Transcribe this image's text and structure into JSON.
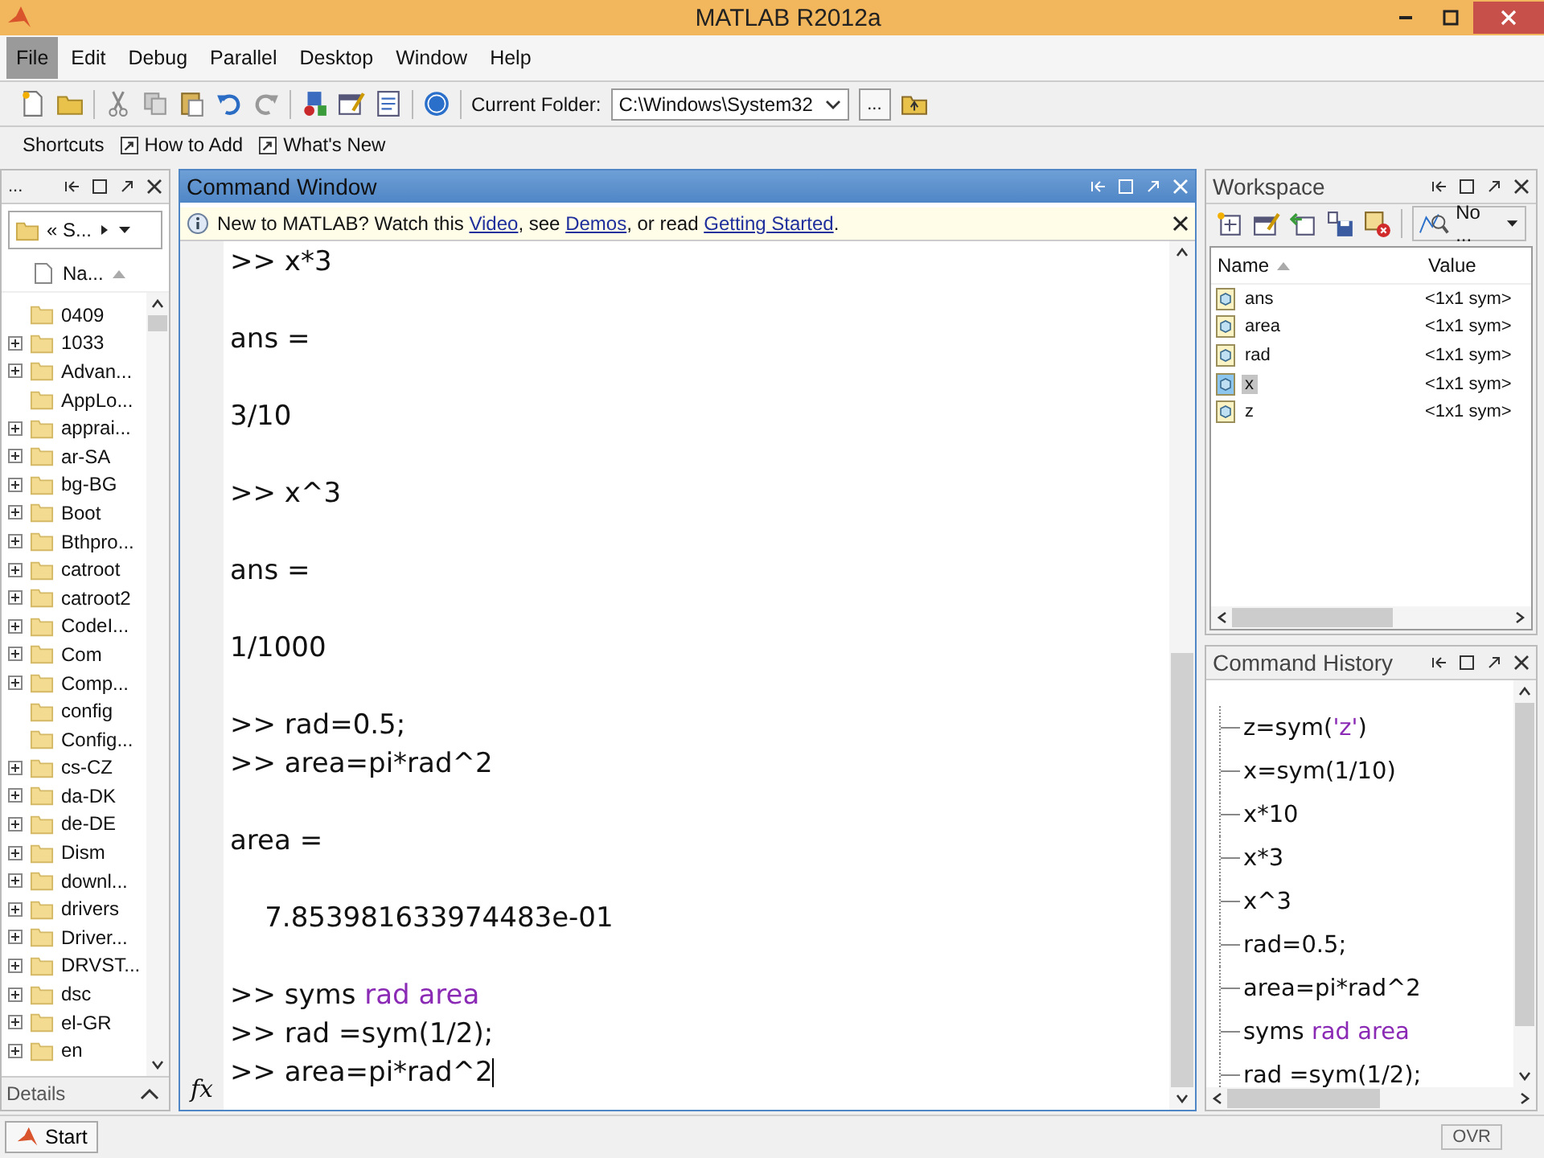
{
  "window": {
    "title": "MATLAB  R2012a"
  },
  "menu": [
    {
      "label": "File",
      "selected": true
    },
    {
      "label": "Edit",
      "selected": false
    },
    {
      "label": "Debug",
      "selected": false
    },
    {
      "label": "Parallel",
      "selected": false
    },
    {
      "label": "Desktop",
      "selected": false
    },
    {
      "label": "Window",
      "selected": false
    },
    {
      "label": "Help",
      "selected": false
    }
  ],
  "toolbar": {
    "current_folder_label": "Current Folder:",
    "current_folder": "C:\\Windows\\System32",
    "browse_button": "..."
  },
  "shortcuts": {
    "title": "Shortcuts",
    "items": [
      "How to Add",
      "What's New"
    ]
  },
  "file_browser": {
    "header": "...",
    "address": "« S...",
    "column": "Na...",
    "details": "Details",
    "items": [
      {
        "name": "0409",
        "expandable": false
      },
      {
        "name": "1033",
        "expandable": true
      },
      {
        "name": "Advan...",
        "expandable": true
      },
      {
        "name": "AppLo...",
        "expandable": false
      },
      {
        "name": "apprai...",
        "expandable": true
      },
      {
        "name": "ar-SA",
        "expandable": true
      },
      {
        "name": "bg-BG",
        "expandable": true
      },
      {
        "name": "Boot",
        "expandable": true
      },
      {
        "name": "Bthpro...",
        "expandable": true
      },
      {
        "name": "catroot",
        "expandable": true
      },
      {
        "name": "catroot2",
        "expandable": true
      },
      {
        "name": "CodeI...",
        "expandable": true
      },
      {
        "name": "Com",
        "expandable": true
      },
      {
        "name": "Comp...",
        "expandable": true
      },
      {
        "name": "config",
        "expandable": false
      },
      {
        "name": "Config...",
        "expandable": false
      },
      {
        "name": "cs-CZ",
        "expandable": true
      },
      {
        "name": "da-DK",
        "expandable": true
      },
      {
        "name": "de-DE",
        "expandable": true
      },
      {
        "name": "Dism",
        "expandable": true
      },
      {
        "name": "downl...",
        "expandable": true
      },
      {
        "name": "drivers",
        "expandable": true
      },
      {
        "name": "Driver...",
        "expandable": true
      },
      {
        "name": "DRVST...",
        "expandable": true
      },
      {
        "name": "dsc",
        "expandable": true
      },
      {
        "name": "el-GR",
        "expandable": true
      },
      {
        "name": "en",
        "expandable": true
      }
    ]
  },
  "command_window": {
    "title": "Command Window",
    "fx": "fx",
    "notice": [
      {
        "text": "New to MATLAB? Watch this ",
        "kind": "text"
      },
      {
        "text": "Video",
        "kind": "link"
      },
      {
        "text": ", see ",
        "kind": "text"
      },
      {
        "text": "Demos",
        "kind": "link"
      },
      {
        "text": ", or read ",
        "kind": "text"
      },
      {
        "text": "Getting Started",
        "kind": "link"
      },
      {
        "text": ".",
        "kind": "text"
      }
    ],
    "lines": [
      {
        "kind": "text",
        "segments": [
          {
            "text": ">> x*3",
            "kind": "code"
          }
        ]
      },
      {
        "kind": "blank"
      },
      {
        "kind": "text",
        "segments": [
          {
            "text": "ans =",
            "kind": "code"
          }
        ]
      },
      {
        "kind": "blank"
      },
      {
        "kind": "text",
        "segments": [
          {
            "text": "3/10",
            "kind": "code"
          }
        ]
      },
      {
        "kind": "blank"
      },
      {
        "kind": "text",
        "segments": [
          {
            "text": ">> x^3",
            "kind": "code"
          }
        ]
      },
      {
        "kind": "blank"
      },
      {
        "kind": "text",
        "segments": [
          {
            "text": "ans =",
            "kind": "code"
          }
        ]
      },
      {
        "kind": "blank"
      },
      {
        "kind": "text",
        "segments": [
          {
            "text": "1/1000",
            "kind": "code"
          }
        ]
      },
      {
        "kind": "blank"
      },
      {
        "kind": "text",
        "segments": [
          {
            "text": ">> rad=0.5;",
            "kind": "code"
          }
        ]
      },
      {
        "kind": "text",
        "segments": [
          {
            "text": ">> area=pi*rad^2",
            "kind": "code"
          }
        ]
      },
      {
        "kind": "blank"
      },
      {
        "kind": "text",
        "segments": [
          {
            "text": "area =",
            "kind": "code"
          }
        ]
      },
      {
        "kind": "blank"
      },
      {
        "kind": "text",
        "segments": [
          {
            "text": "    7.853981633974483e-01",
            "kind": "code"
          }
        ]
      },
      {
        "kind": "blank"
      },
      {
        "kind": "text",
        "segments": [
          {
            "text": ">> syms ",
            "kind": "code"
          },
          {
            "text": "rad area",
            "kind": "string"
          }
        ]
      },
      {
        "kind": "text",
        "segments": [
          {
            "text": ">> rad =sym(1/2);",
            "kind": "code"
          }
        ]
      },
      {
        "kind": "text",
        "segments": [
          {
            "text": ">> area=pi*rad^2",
            "kind": "code"
          }
        ]
      }
    ]
  },
  "workspace": {
    "title": "Workspace",
    "filter": "No ...",
    "columns": [
      "Name",
      "Value"
    ],
    "rows": [
      {
        "name": "ans",
        "value": "<1x1 sym>",
        "selected": false
      },
      {
        "name": "area",
        "value": "<1x1 sym>",
        "selected": false
      },
      {
        "name": "rad",
        "value": "<1x1 sym>",
        "selected": false
      },
      {
        "name": "x",
        "value": "<1x1 sym>",
        "selected": true
      },
      {
        "name": "z",
        "value": "<1x1 sym>",
        "selected": false
      }
    ]
  },
  "command_history": {
    "title": "Command History",
    "items": [
      [
        {
          "text": "z=sym(",
          "kind": "code"
        },
        {
          "text": "'z'",
          "kind": "string"
        },
        {
          "text": ")",
          "kind": "code"
        }
      ],
      [
        {
          "text": "x=sym(1/10)",
          "kind": "code"
        }
      ],
      [
        {
          "text": "x*10",
          "kind": "code"
        }
      ],
      [
        {
          "text": "x*3",
          "kind": "code"
        }
      ],
      [
        {
          "text": "x^3",
          "kind": "code"
        }
      ],
      [
        {
          "text": "rad=0.5;",
          "kind": "code"
        }
      ],
      [
        {
          "text": "area=pi*rad^2",
          "kind": "code"
        }
      ],
      [
        {
          "text": "syms ",
          "kind": "code"
        },
        {
          "text": "rad area",
          "kind": "string"
        }
      ],
      [
        {
          "text": "rad =sym(1/2);",
          "kind": "code"
        }
      ]
    ]
  },
  "status_bar": {
    "start": "Start",
    "mode": "OVR"
  }
}
